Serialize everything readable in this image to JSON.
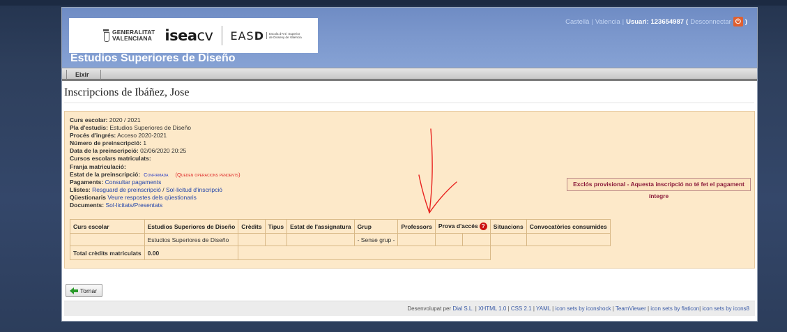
{
  "header": {
    "logos": {
      "generalitat_line1": "GENERALITAT",
      "generalitat_line2": "VALENCIANA",
      "isea_bold": "isea",
      "isea_thin": "cv",
      "easd_thin": "EAS",
      "easd_bold": "D",
      "easd_sub_line1": "Escola d'Art i Superior",
      "easd_sub_line2": "de Disseny de València"
    },
    "site_title": "Estudios Superiores de Diseño",
    "userbar": {
      "lang_castella": "Castellà",
      "sep1": "|",
      "lang_valencia": "Valencia",
      "sep2": "|",
      "user": "Usuari: 123654987",
      "logout_open": "(",
      "logout": "Desconnectar",
      "logout_close": ")",
      "power_glyph": "⏻"
    }
  },
  "nav": {
    "exit_label": "Eixir"
  },
  "page_title": "Inscripcions de Ibáñez, Jose",
  "info": {
    "curs_label": "Curs escolar:",
    "curs_value": "2020 / 2021",
    "pla_label": "Pla d'estudis:",
    "pla_value": "Estudios Superiores de Diseño",
    "proces_label": "Procés d'ingrés:",
    "proces_value": "Acceso 2020-2021",
    "numero_label": "Número de preinscripció:",
    "numero_value": "1",
    "data_label": "Data de la preinscripció:",
    "data_value": "02/06/2020 20:25",
    "cursos_label": "Cursos escolars matriculats:",
    "franja_label": "Franja matriculació:",
    "estat_label": "Estat de la preinscripció:",
    "estat_value": "Confirmada",
    "estat_pending": "(Queden operacions pendents)",
    "pagaments_label": "Pagaments:",
    "pagaments_link": "Consultar pagaments",
    "llistes_label": "Llistes:",
    "llistes_link1": "Resguard de preinscripció",
    "llistes_sep": "/",
    "llistes_link2": "Sol·licitud d'inscripció",
    "questionaris_label": "Qüestionaris",
    "questionaris_link": "Veure respostes dels qüestionaris",
    "documents_label": "Documents:",
    "documents_link": "Sol·licitats/Presentats"
  },
  "warning": "Exclós provisional - Aquesta inscripció no té fet el pagament íntegre",
  "table": {
    "headers": [
      "Curs escolar",
      "Estudios Superiores de Diseño",
      "Crèdits",
      "Tipus",
      "Estat de l'assignatura",
      "Grup",
      "Professors",
      "Prova d'accés",
      "Situacions",
      "Convocatòries consumides"
    ],
    "row1_subject": "Estudios Superiores de Diseño",
    "row1_group": "- Sense grup -",
    "total_label": "Total crèdits matriculats",
    "total_value": "0.00"
  },
  "back_button": "Tornar",
  "footer": {
    "prefix": "Desenvolupat per",
    "links": [
      "Dial S.L.",
      "XHTML 1.0",
      "CSS 2.1",
      "YAML",
      "icon sets by iconshock",
      "TeamViewer",
      "icon sets by flaticon",
      "icon sets by icons8"
    ]
  },
  "colors": {
    "header_blue": "#7c98cd",
    "panel_bg": "#fde9c9",
    "annotation_red": "#e8231f"
  }
}
